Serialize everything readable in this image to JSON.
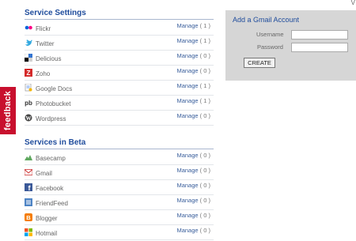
{
  "feedback_label": "feedback",
  "corner_fragment": "V",
  "service_settings": {
    "title": "Service Settings",
    "items": [
      {
        "name": "Flickr",
        "manage": "Manage",
        "count": "( 1 )",
        "icon": "flickr-icon"
      },
      {
        "name": "Twitter",
        "manage": "Manage",
        "count": "( 1 )",
        "icon": "twitter-icon"
      },
      {
        "name": "Delicious",
        "manage": "Manage",
        "count": "( 0 )",
        "icon": "delicious-icon"
      },
      {
        "name": "Zoho",
        "manage": "Manage",
        "count": "( 0 )",
        "icon": "zoho-icon"
      },
      {
        "name": "Google Docs",
        "manage": "Manage",
        "count": "( 1 )",
        "icon": "google-docs-icon"
      },
      {
        "name": "Photobucket",
        "manage": "Manage",
        "count": "( 1 )",
        "icon": "photobucket-icon"
      },
      {
        "name": "Wordpress",
        "manage": "Manage",
        "count": "( 0 )",
        "icon": "wordpress-icon"
      }
    ]
  },
  "services_beta": {
    "title": "Services in Beta",
    "items": [
      {
        "name": "Basecamp",
        "manage": "Manage",
        "count": "( 0 )",
        "icon": "basecamp-icon"
      },
      {
        "name": "Gmail",
        "manage": "Manage",
        "count": "( 0 )",
        "icon": "gmail-icon"
      },
      {
        "name": "Facebook",
        "manage": "Manage",
        "count": "( 0 )",
        "icon": "facebook-icon"
      },
      {
        "name": "FriendFeed",
        "manage": "Manage",
        "count": "( 0 )",
        "icon": "friendfeed-icon"
      },
      {
        "name": "Blogger",
        "manage": "Manage",
        "count": "( 0 )",
        "icon": "blogger-icon"
      },
      {
        "name": "Hotmail",
        "manage": "Manage",
        "count": "( 0 )",
        "icon": "hotmail-icon"
      }
    ]
  },
  "gmail_panel": {
    "title": "Add a Gmail Account",
    "username_label": "Username",
    "password_label": "Password",
    "username_value": "",
    "password_value": "",
    "create_label": "CREATE"
  },
  "colors": {
    "link": "#3a5f9c",
    "heading": "#1f4c9c",
    "feedback_tab": "#c8102e",
    "panel_bg": "#d6d6d6"
  }
}
